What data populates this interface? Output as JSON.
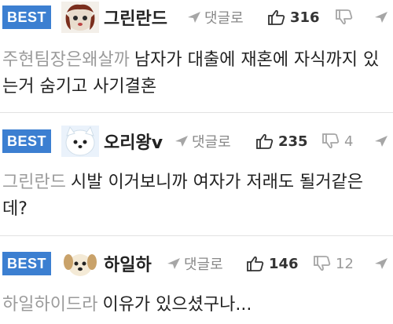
{
  "comments": [
    {
      "badge": "BEST",
      "nickname": "그린란드",
      "reply_label": "댓글로",
      "likes": "316",
      "dislikes": "",
      "mention": "주현팀장은왜살까",
      "text": "남자가 대출에 재혼에 자식까지 있는거 숨기고 사기결혼"
    },
    {
      "badge": "BEST",
      "nickname": "오리왕v",
      "reply_label": "댓글로",
      "likes": "235",
      "dislikes": "4",
      "mention": "그린란드",
      "text": "시발 이거보니까 여자가 저래도 될거같은데?"
    },
    {
      "badge": "BEST",
      "nickname": "하일하",
      "reply_label": "댓글로",
      "likes": "146",
      "dislikes": "12",
      "mention": "하일하이드라",
      "text": "이유가 있으셨구나..."
    }
  ],
  "colors": {
    "badge": "#3c7fd1",
    "mention": "#9b9b9b",
    "meta": "#888888"
  },
  "icons": {
    "reply": "reply-arrow-icon",
    "like": "thumbs-up-icon",
    "dislike": "thumbs-down-icon"
  }
}
